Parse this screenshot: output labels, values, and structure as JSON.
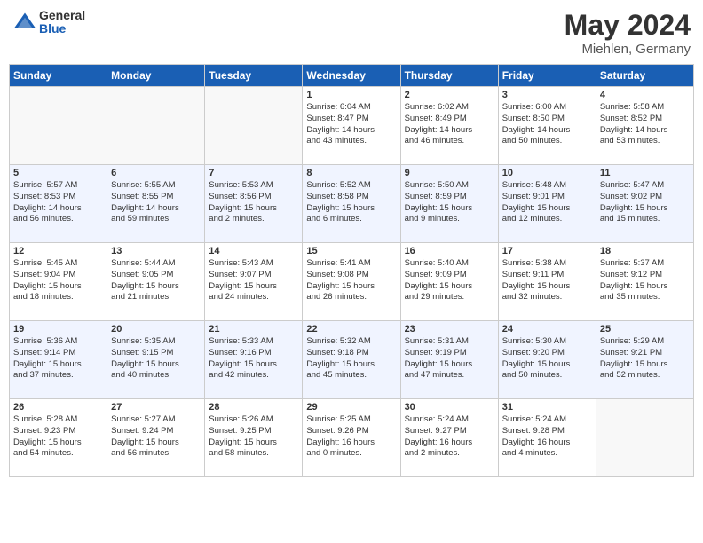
{
  "header": {
    "logo_general": "General",
    "logo_blue": "Blue",
    "title": "May 2024",
    "location": "Miehlen, Germany"
  },
  "weekdays": [
    "Sunday",
    "Monday",
    "Tuesday",
    "Wednesday",
    "Thursday",
    "Friday",
    "Saturday"
  ],
  "weeks": [
    [
      {
        "day": "",
        "content": ""
      },
      {
        "day": "",
        "content": ""
      },
      {
        "day": "",
        "content": ""
      },
      {
        "day": "1",
        "content": "Sunrise: 6:04 AM\nSunset: 8:47 PM\nDaylight: 14 hours\nand 43 minutes."
      },
      {
        "day": "2",
        "content": "Sunrise: 6:02 AM\nSunset: 8:49 PM\nDaylight: 14 hours\nand 46 minutes."
      },
      {
        "day": "3",
        "content": "Sunrise: 6:00 AM\nSunset: 8:50 PM\nDaylight: 14 hours\nand 50 minutes."
      },
      {
        "day": "4",
        "content": "Sunrise: 5:58 AM\nSunset: 8:52 PM\nDaylight: 14 hours\nand 53 minutes."
      }
    ],
    [
      {
        "day": "5",
        "content": "Sunrise: 5:57 AM\nSunset: 8:53 PM\nDaylight: 14 hours\nand 56 minutes."
      },
      {
        "day": "6",
        "content": "Sunrise: 5:55 AM\nSunset: 8:55 PM\nDaylight: 14 hours\nand 59 minutes."
      },
      {
        "day": "7",
        "content": "Sunrise: 5:53 AM\nSunset: 8:56 PM\nDaylight: 15 hours\nand 2 minutes."
      },
      {
        "day": "8",
        "content": "Sunrise: 5:52 AM\nSunset: 8:58 PM\nDaylight: 15 hours\nand 6 minutes."
      },
      {
        "day": "9",
        "content": "Sunrise: 5:50 AM\nSunset: 8:59 PM\nDaylight: 15 hours\nand 9 minutes."
      },
      {
        "day": "10",
        "content": "Sunrise: 5:48 AM\nSunset: 9:01 PM\nDaylight: 15 hours\nand 12 minutes."
      },
      {
        "day": "11",
        "content": "Sunrise: 5:47 AM\nSunset: 9:02 PM\nDaylight: 15 hours\nand 15 minutes."
      }
    ],
    [
      {
        "day": "12",
        "content": "Sunrise: 5:45 AM\nSunset: 9:04 PM\nDaylight: 15 hours\nand 18 minutes."
      },
      {
        "day": "13",
        "content": "Sunrise: 5:44 AM\nSunset: 9:05 PM\nDaylight: 15 hours\nand 21 minutes."
      },
      {
        "day": "14",
        "content": "Sunrise: 5:43 AM\nSunset: 9:07 PM\nDaylight: 15 hours\nand 24 minutes."
      },
      {
        "day": "15",
        "content": "Sunrise: 5:41 AM\nSunset: 9:08 PM\nDaylight: 15 hours\nand 26 minutes."
      },
      {
        "day": "16",
        "content": "Sunrise: 5:40 AM\nSunset: 9:09 PM\nDaylight: 15 hours\nand 29 minutes."
      },
      {
        "day": "17",
        "content": "Sunrise: 5:38 AM\nSunset: 9:11 PM\nDaylight: 15 hours\nand 32 minutes."
      },
      {
        "day": "18",
        "content": "Sunrise: 5:37 AM\nSunset: 9:12 PM\nDaylight: 15 hours\nand 35 minutes."
      }
    ],
    [
      {
        "day": "19",
        "content": "Sunrise: 5:36 AM\nSunset: 9:14 PM\nDaylight: 15 hours\nand 37 minutes."
      },
      {
        "day": "20",
        "content": "Sunrise: 5:35 AM\nSunset: 9:15 PM\nDaylight: 15 hours\nand 40 minutes."
      },
      {
        "day": "21",
        "content": "Sunrise: 5:33 AM\nSunset: 9:16 PM\nDaylight: 15 hours\nand 42 minutes."
      },
      {
        "day": "22",
        "content": "Sunrise: 5:32 AM\nSunset: 9:18 PM\nDaylight: 15 hours\nand 45 minutes."
      },
      {
        "day": "23",
        "content": "Sunrise: 5:31 AM\nSunset: 9:19 PM\nDaylight: 15 hours\nand 47 minutes."
      },
      {
        "day": "24",
        "content": "Sunrise: 5:30 AM\nSunset: 9:20 PM\nDaylight: 15 hours\nand 50 minutes."
      },
      {
        "day": "25",
        "content": "Sunrise: 5:29 AM\nSunset: 9:21 PM\nDaylight: 15 hours\nand 52 minutes."
      }
    ],
    [
      {
        "day": "26",
        "content": "Sunrise: 5:28 AM\nSunset: 9:23 PM\nDaylight: 15 hours\nand 54 minutes."
      },
      {
        "day": "27",
        "content": "Sunrise: 5:27 AM\nSunset: 9:24 PM\nDaylight: 15 hours\nand 56 minutes."
      },
      {
        "day": "28",
        "content": "Sunrise: 5:26 AM\nSunset: 9:25 PM\nDaylight: 15 hours\nand 58 minutes."
      },
      {
        "day": "29",
        "content": "Sunrise: 5:25 AM\nSunset: 9:26 PM\nDaylight: 16 hours\nand 0 minutes."
      },
      {
        "day": "30",
        "content": "Sunrise: 5:24 AM\nSunset: 9:27 PM\nDaylight: 16 hours\nand 2 minutes."
      },
      {
        "day": "31",
        "content": "Sunrise: 5:24 AM\nSunset: 9:28 PM\nDaylight: 16 hours\nand 4 minutes."
      },
      {
        "day": "",
        "content": ""
      }
    ]
  ]
}
